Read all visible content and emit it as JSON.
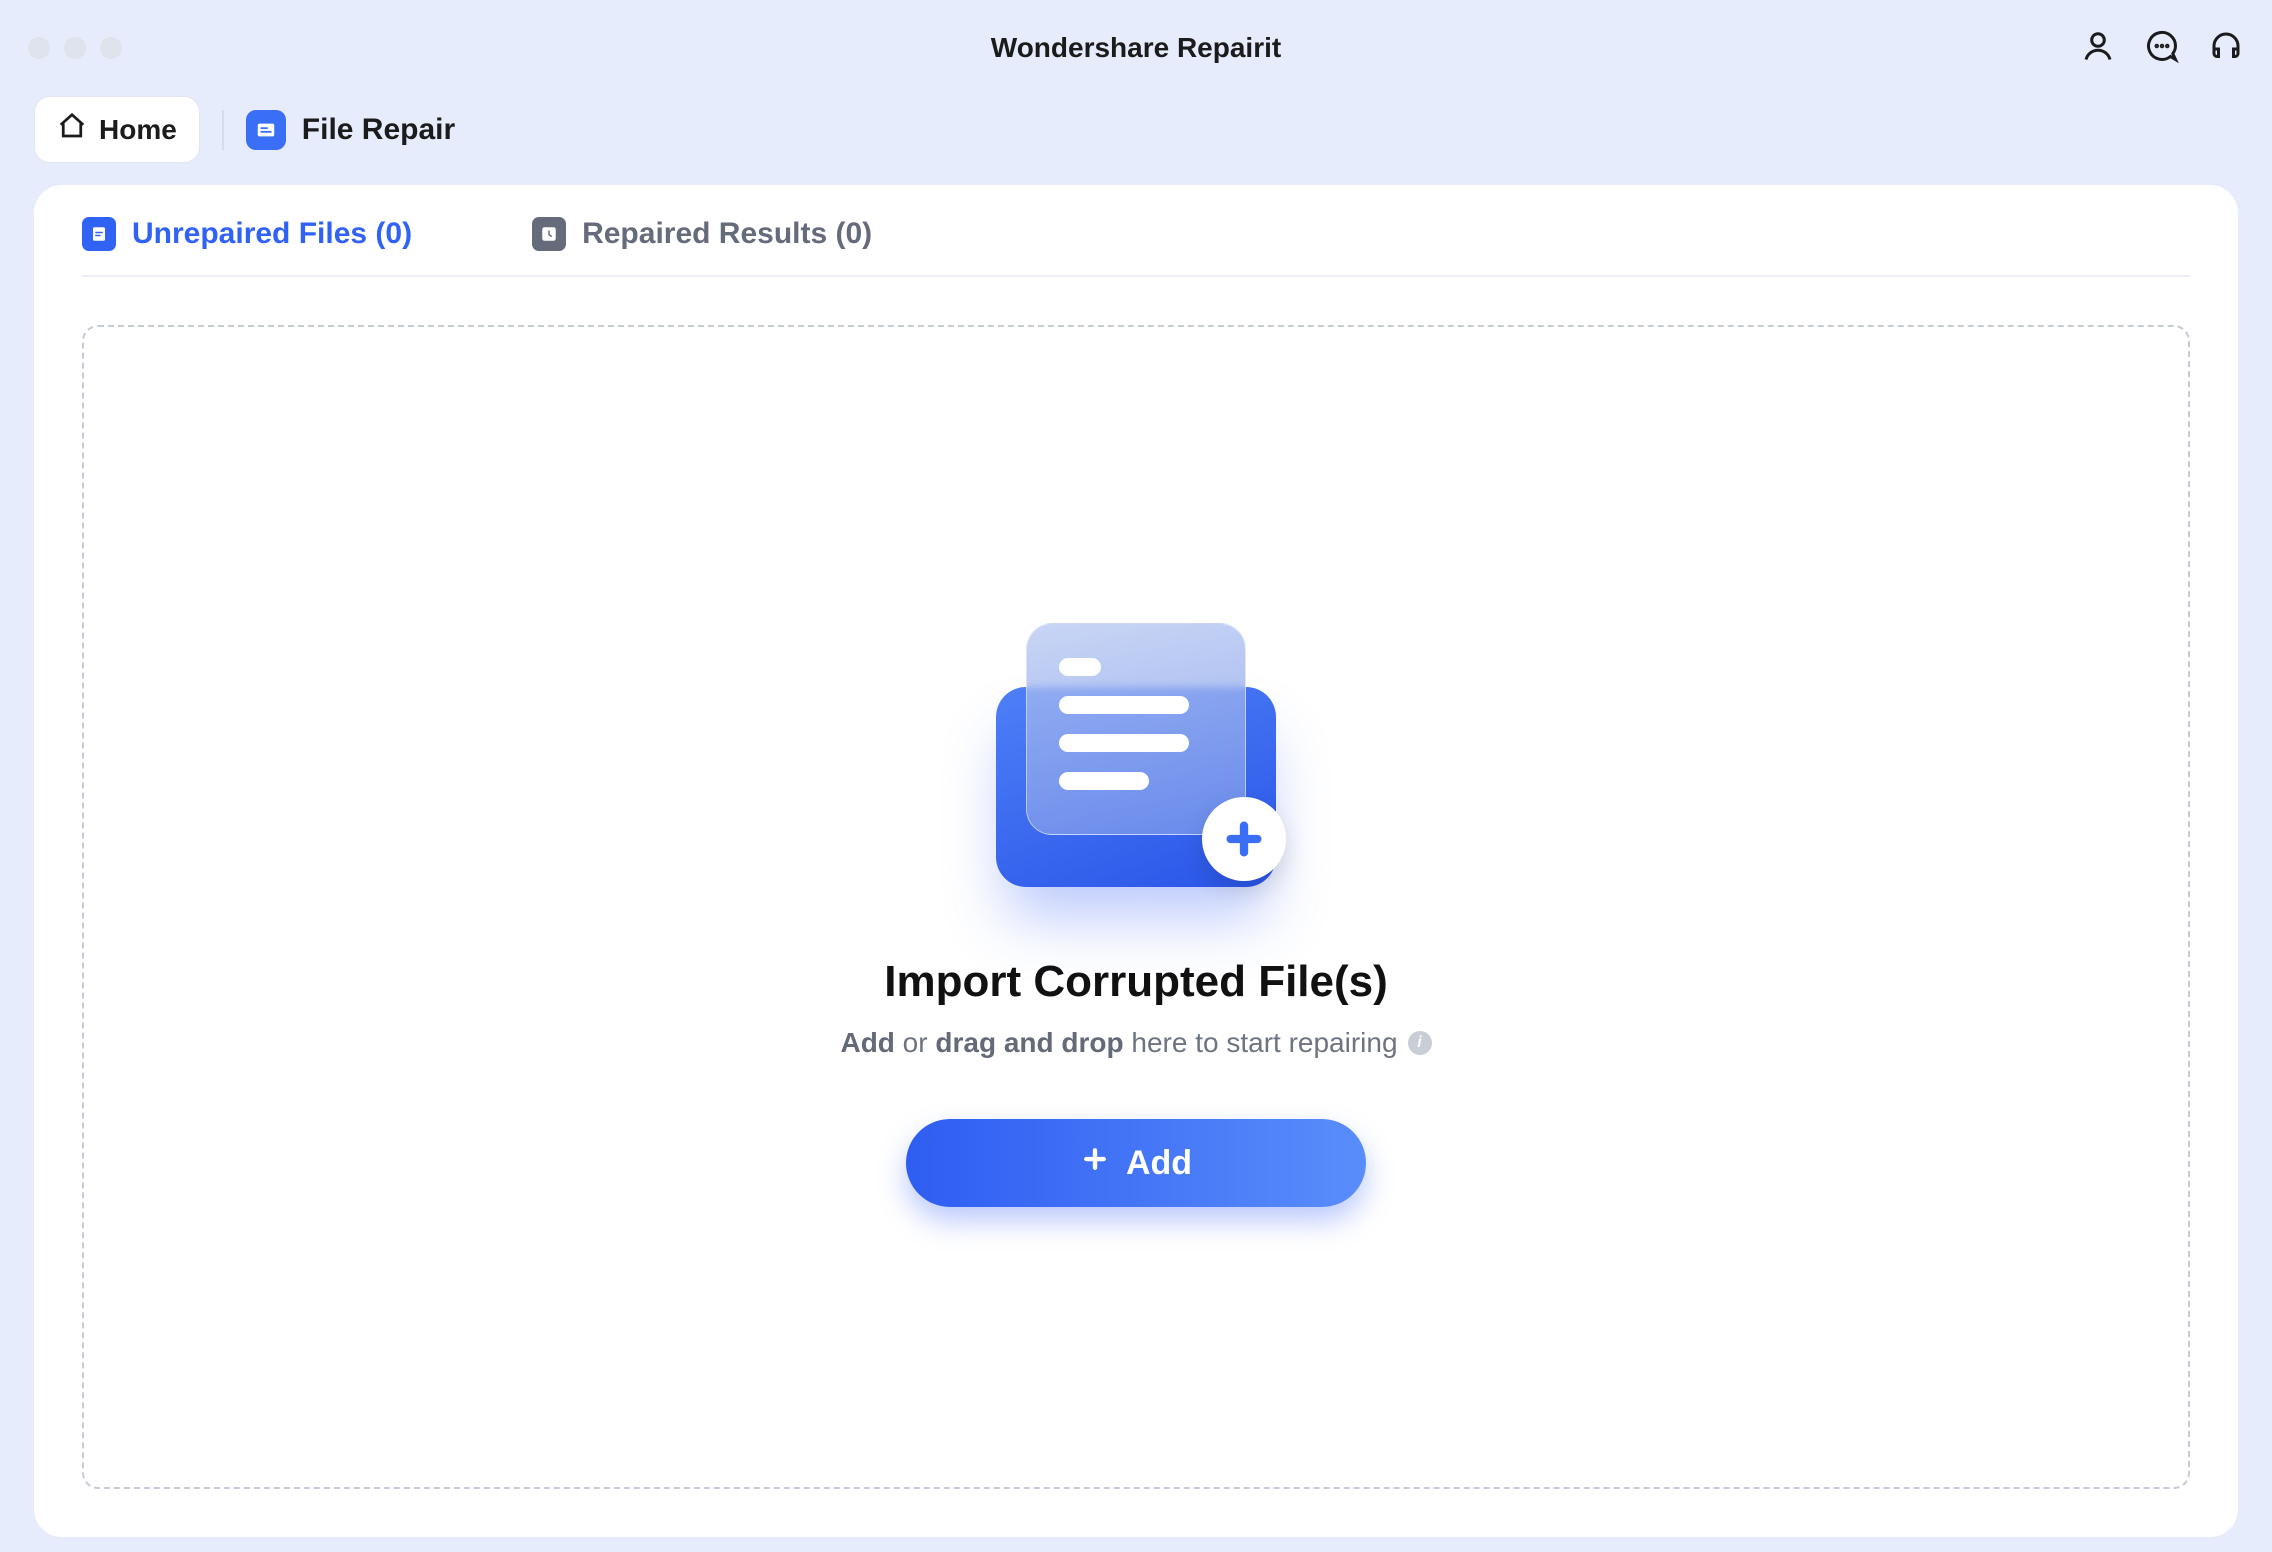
{
  "titlebar": {
    "title": "Wondershare Repairit"
  },
  "breadcrumb": {
    "home_label": "Home",
    "current_label": "File Repair"
  },
  "tabs": {
    "unrepaired": {
      "label": "Unrepaired Files (0)"
    },
    "repaired": {
      "label": "Repaired Results (0)"
    }
  },
  "dropzone": {
    "heading": "Import Corrupted File(s)",
    "sub_prefix_bold": "Add",
    "sub_or": " or ",
    "sub_bold2": "drag and drop",
    "sub_rest": " here to start repairing",
    "add_label": "Add"
  }
}
